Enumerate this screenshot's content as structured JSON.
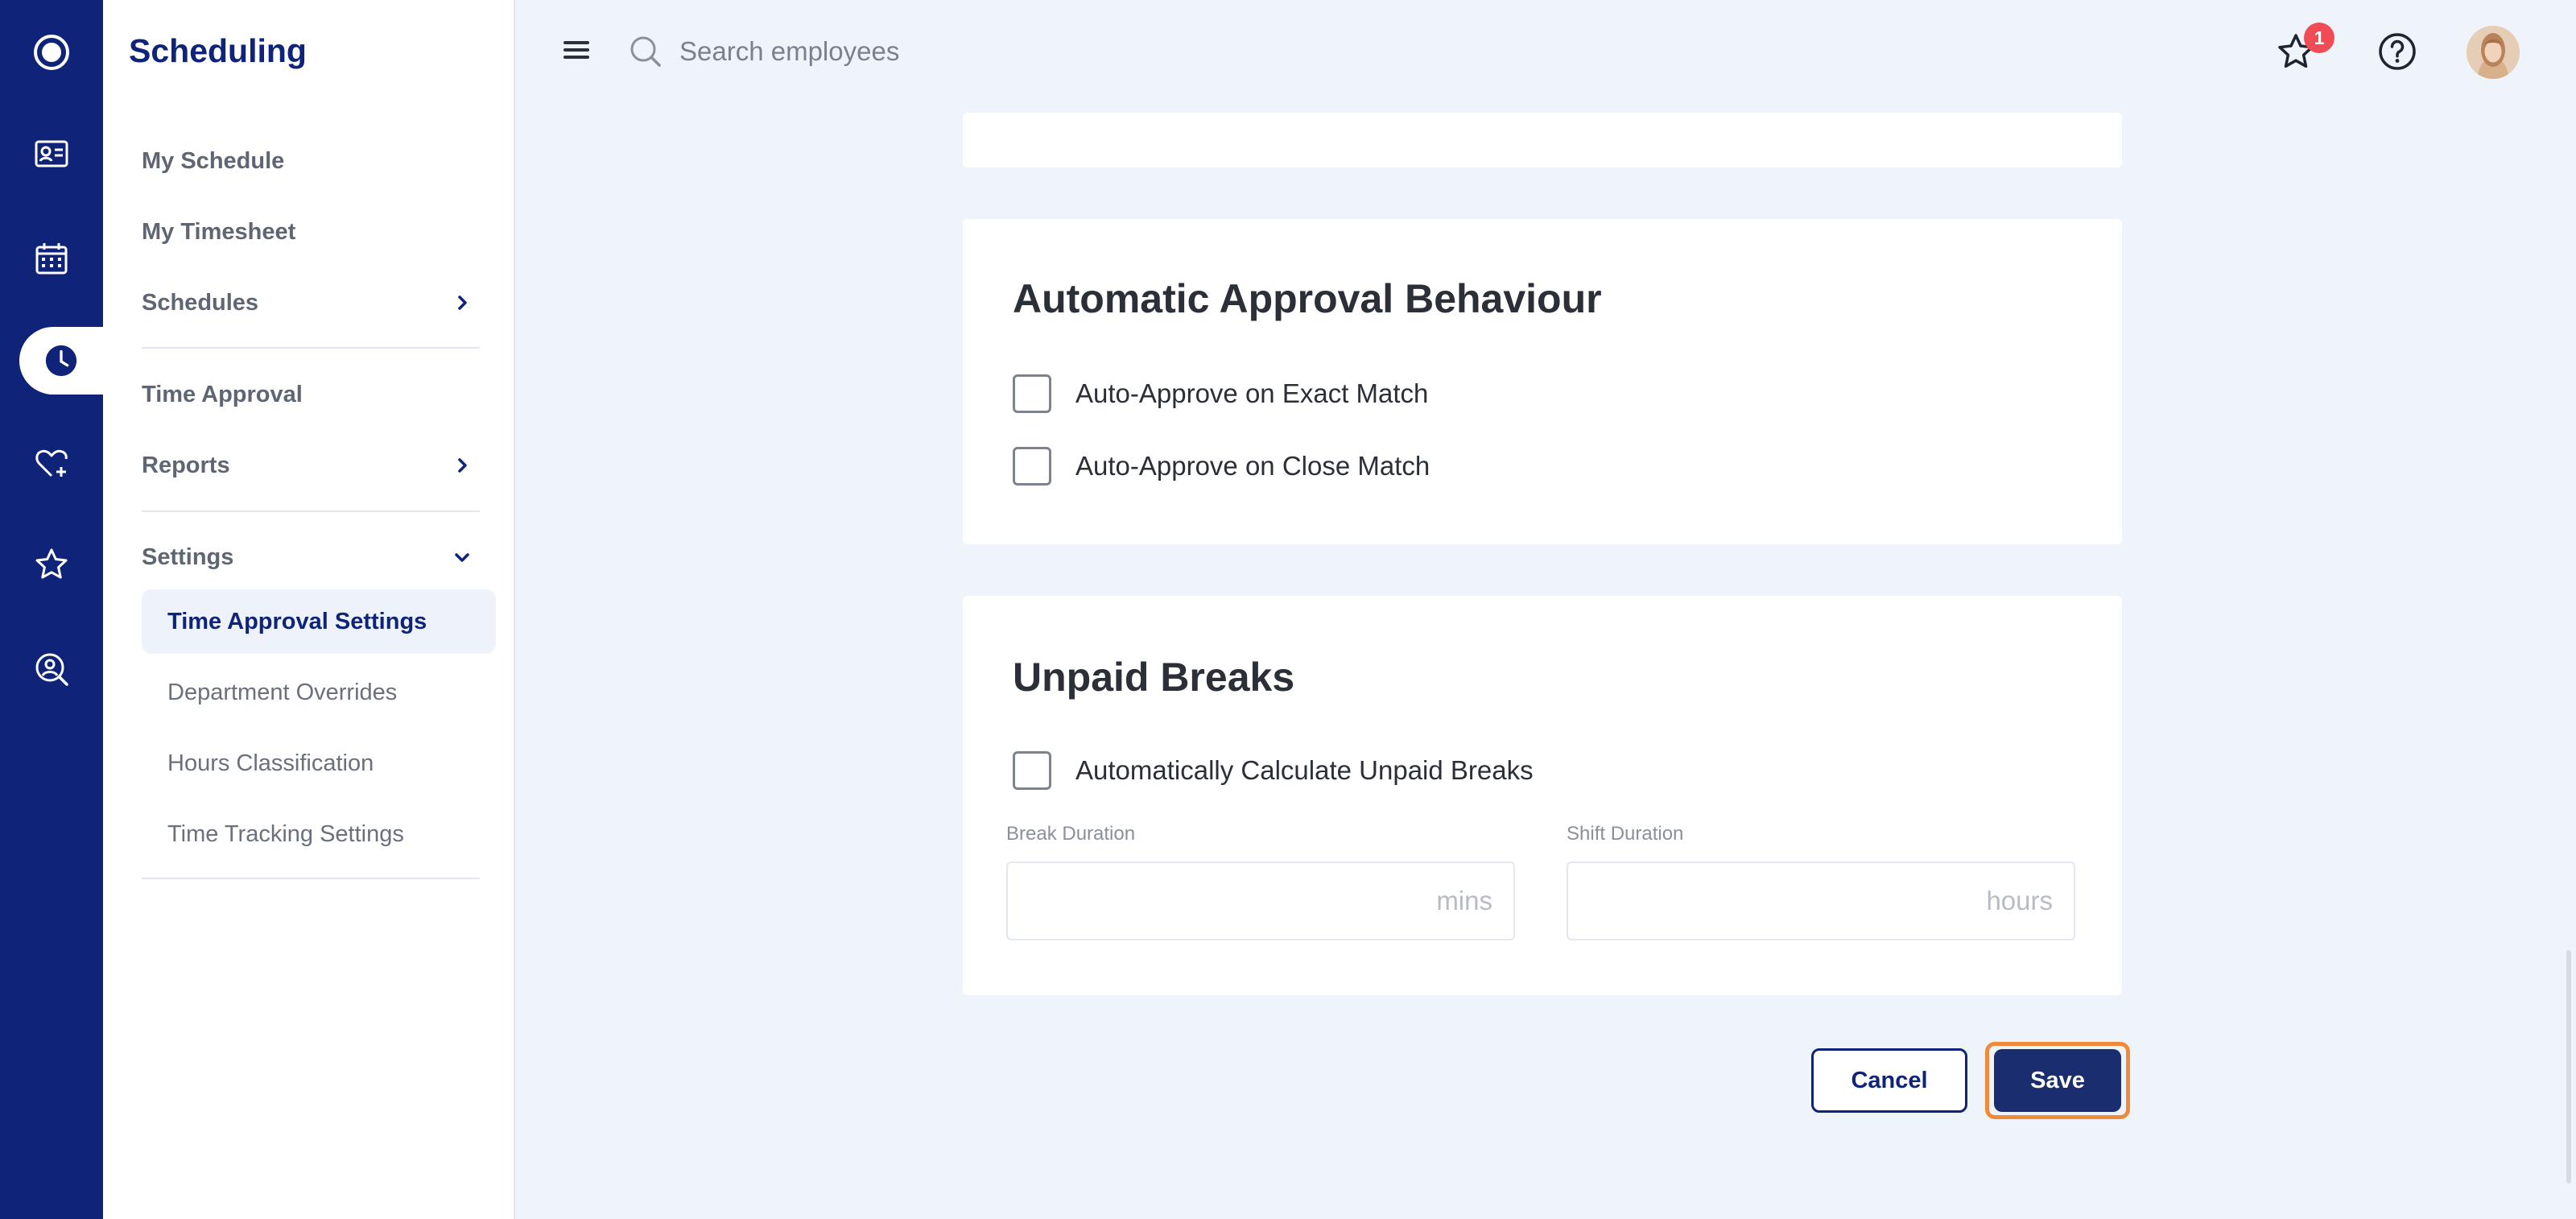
{
  "app": {
    "title": "Scheduling"
  },
  "rail": {
    "items": [
      {
        "icon": "logo-icon"
      },
      {
        "icon": "id-card-icon"
      },
      {
        "icon": "calendar-icon"
      },
      {
        "icon": "clock-icon",
        "active": true
      },
      {
        "icon": "heart-plus-icon"
      },
      {
        "icon": "star-icon"
      },
      {
        "icon": "user-search-icon"
      }
    ]
  },
  "sidebar": {
    "items": [
      {
        "label": "My Schedule"
      },
      {
        "label": "My Timesheet"
      },
      {
        "label": "Schedules",
        "chevron": "right"
      },
      {
        "label": "Time Approval"
      },
      {
        "label": "Reports",
        "chevron": "right"
      },
      {
        "label": "Settings",
        "chevron": "down"
      }
    ],
    "settings_children": [
      {
        "label": "Time Approval Settings",
        "active": true
      },
      {
        "label": "Department Overrides"
      },
      {
        "label": "Hours Classification"
      },
      {
        "label": "Time Tracking Settings"
      }
    ]
  },
  "topbar": {
    "search_placeholder": "Search employees",
    "notification_count": "1"
  },
  "approval_card": {
    "heading": "Automatic Approval Behaviour",
    "options": [
      {
        "label": "Auto-Approve on Exact Match",
        "checked": false
      },
      {
        "label": "Auto-Approve on Close Match",
        "checked": false
      }
    ]
  },
  "breaks_card": {
    "heading": "Unpaid Breaks",
    "option": {
      "label": "Automatically Calculate Unpaid Breaks",
      "checked": false
    },
    "break_duration": {
      "label": "Break Duration",
      "placeholder": "mins",
      "value": ""
    },
    "shift_duration": {
      "label": "Shift Duration",
      "placeholder": "hours",
      "value": ""
    }
  },
  "actions": {
    "cancel_label": "Cancel",
    "save_label": "Save"
  },
  "colors": {
    "primary": "#0f2478",
    "save_button": "#1a2d6e",
    "focus_outline": "#ef8a3a",
    "badge": "#f14c55",
    "page_background": "#eff3fa"
  }
}
